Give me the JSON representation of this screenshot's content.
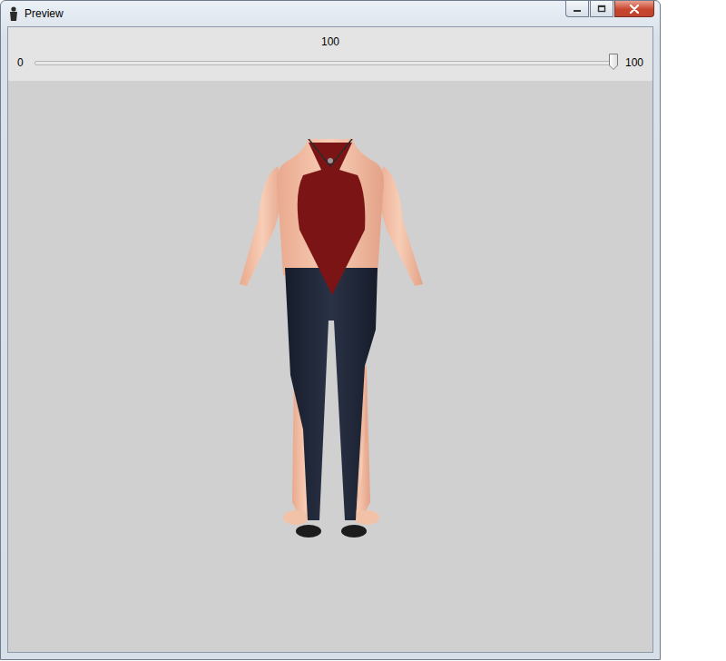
{
  "window": {
    "title": "Preview"
  },
  "slider": {
    "value": "100",
    "min": "0",
    "max": "100",
    "level": 1.0
  }
}
